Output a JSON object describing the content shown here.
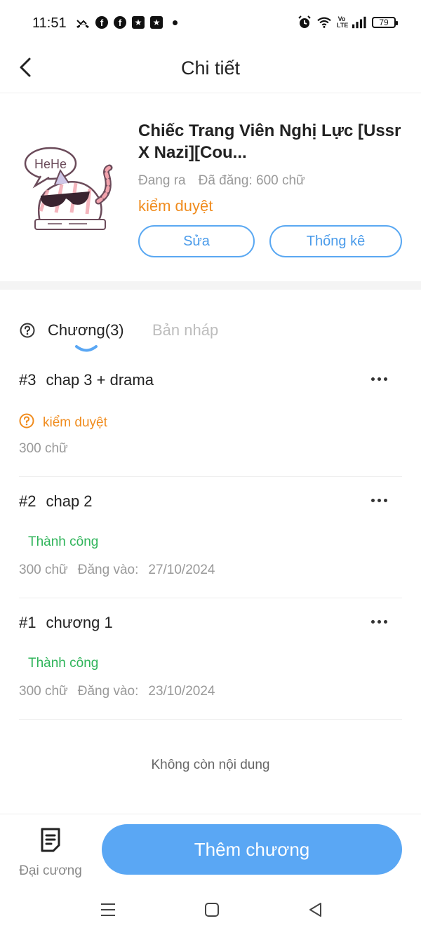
{
  "status_bar": {
    "time": "11:51",
    "battery": "79",
    "volte": "Vo LTE",
    "icons": [
      "missed-call-icon",
      "facebook-icon",
      "facebook-icon",
      "app-icon",
      "app-icon",
      "dot-icon",
      "alarm-icon",
      "wifi-icon",
      "volte-icon",
      "signal-icon",
      "battery-icon"
    ]
  },
  "header": {
    "title": "Chi tiết",
    "back_icon": "chevron-left-icon"
  },
  "story": {
    "title": "Chiếc Trang Viên Nghị Lực [Ussr X Nazi][Cou...",
    "status": "Đang ra",
    "words": "Đã đăng: 600 chữ",
    "review_status": "kiểm  duyệt",
    "edit_label": "Sửa",
    "stats_label": "Thống kê",
    "cover_text": "HeHe"
  },
  "tabs": {
    "chapters": "Chương(3)",
    "drafts": "Bản nháp"
  },
  "chapters": [
    {
      "num": "#3",
      "title": "chap 3 + drama",
      "status": "kiểm duyệt",
      "words": "300 chữ",
      "published_label": "",
      "date": ""
    },
    {
      "num": "#2",
      "title": "chap 2",
      "status": "Thành công",
      "words": "300 chữ",
      "published_label": "Đăng vào:",
      "date": "27/10/2024"
    },
    {
      "num": "#1",
      "title": "chương 1",
      "status": "Thành công",
      "words": "300 chữ",
      "published_label": "Đăng vào:",
      "date": "23/10/2024"
    }
  ],
  "no_more": "Không còn nội dung",
  "bottom": {
    "outline_label": "Đại cương",
    "add_label": "Thêm chương"
  },
  "colors": {
    "accent": "#5aa7f4",
    "review": "#f08c1e",
    "success": "#2fb45a"
  }
}
